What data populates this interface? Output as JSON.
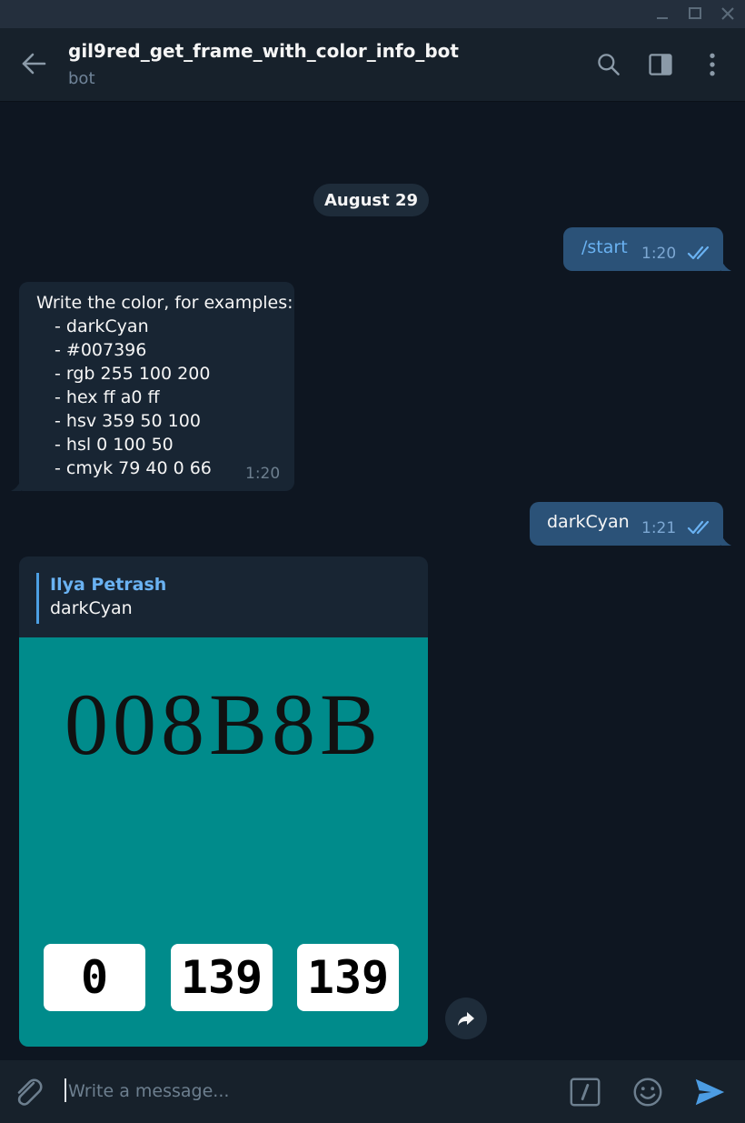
{
  "window": {
    "controls": [
      "minimize-icon",
      "maximize-icon",
      "close-icon"
    ]
  },
  "header": {
    "title": "gil9red_get_frame_with_color_info_bot",
    "subtitle": "bot",
    "icons": [
      "back-arrow-icon",
      "search-icon",
      "sidebar-toggle-icon",
      "more-vertical-icon"
    ]
  },
  "messages": {
    "date_separator": "August 29",
    "start": {
      "text": "/start",
      "time": "1:20",
      "status": "read"
    },
    "bot_help": {
      "lines": [
        "Write the color, for examples:",
        "- darkCyan",
        "- #007396",
        "- rgb 255 100 200",
        "- hex ff a0 ff",
        "- hsv 359 50 100",
        "- hsl 0 100 50",
        "- cmyk 79 40 0 66"
      ],
      "time": "1:20"
    },
    "dark_cyan": {
      "text": "darkCyan",
      "time": "1:21",
      "status": "read"
    },
    "photo_reply": {
      "reply_author": "Ilya Petrash",
      "reply_text": "darkCyan",
      "image": {
        "background": "#008b8b",
        "hex": "008B8B",
        "rgb": [
          "0",
          "139",
          "139"
        ]
      },
      "share_icon": "share-arrow-icon"
    }
  },
  "composer": {
    "placeholder": "Write a message...",
    "icons": [
      "attach-icon",
      "bot-command-icon",
      "emoji-icon",
      "send-icon"
    ]
  },
  "colors": {
    "background": "#0e1621",
    "header": "#17212b",
    "outgoing_bubble": "#2b5278",
    "incoming_bubble": "#182533",
    "accent": "#6ab2f2"
  }
}
